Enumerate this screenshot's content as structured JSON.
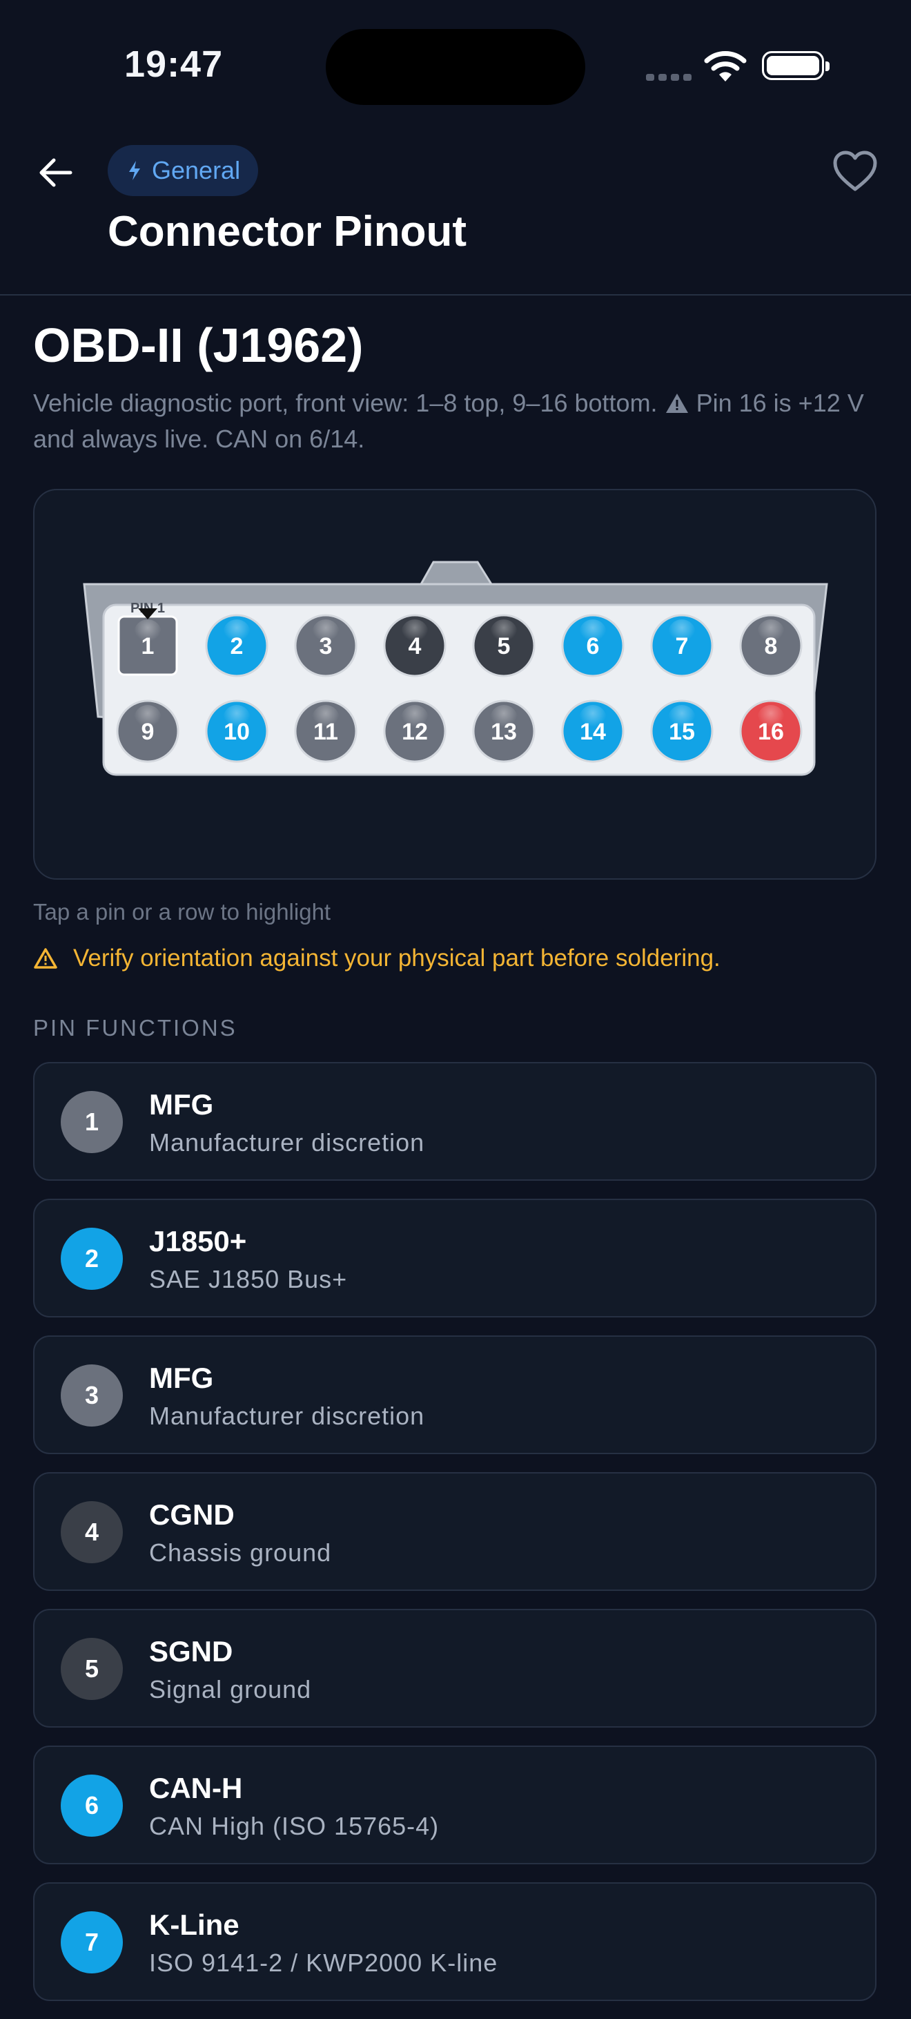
{
  "status": {
    "time": "19:47"
  },
  "header": {
    "category_chip": "General",
    "title": "Connector Pinout",
    "icons": {
      "back": "arrow-left-icon",
      "category": "bolt-icon",
      "favorite": "heart-icon"
    }
  },
  "connector": {
    "title": "OBD-II (J1962)",
    "description_part1": "Vehicle diagnostic port, front view: 1–8 top, 9–16 bottom.",
    "description_part2": "Pin 16 is +12 V and always live. CAN on 6/14.",
    "pin1_marker": "PIN 1",
    "top_row": [
      {
        "n": "1",
        "kind": "pin1"
      },
      {
        "n": "2",
        "kind": "blue"
      },
      {
        "n": "3",
        "kind": "gray"
      },
      {
        "n": "4",
        "kind": "dark"
      },
      {
        "n": "5",
        "kind": "dark"
      },
      {
        "n": "6",
        "kind": "blue"
      },
      {
        "n": "7",
        "kind": "blue"
      },
      {
        "n": "8",
        "kind": "gray"
      }
    ],
    "bottom_row": [
      {
        "n": "9",
        "kind": "gray"
      },
      {
        "n": "10",
        "kind": "blue"
      },
      {
        "n": "11",
        "kind": "gray"
      },
      {
        "n": "12",
        "kind": "gray"
      },
      {
        "n": "13",
        "kind": "gray"
      },
      {
        "n": "14",
        "kind": "blue"
      },
      {
        "n": "15",
        "kind": "blue"
      },
      {
        "n": "16",
        "kind": "red"
      }
    ],
    "hint": "Tap a pin or a row to highlight",
    "caution": "Verify orientation against your physical part before soldering."
  },
  "colors": {
    "blue": "#12a3e6",
    "gray": "#6b717d",
    "dark": "#3a3f48",
    "red": "#e5484d",
    "caution": "#f4b534",
    "chip_text": "#61a8f3"
  },
  "pin_functions": {
    "label": "PIN FUNCTIONS",
    "items": [
      {
        "num": "1",
        "name": "MFG",
        "desc": "Manufacturer discretion",
        "color": "#6b717d"
      },
      {
        "num": "2",
        "name": "J1850+",
        "desc": "SAE J1850 Bus+",
        "color": "#12a3e6"
      },
      {
        "num": "3",
        "name": "MFG",
        "desc": "Manufacturer discretion",
        "color": "#6b717d"
      },
      {
        "num": "4",
        "name": "CGND",
        "desc": "Chassis ground",
        "color": "#3a3f48"
      },
      {
        "num": "5",
        "name": "SGND",
        "desc": "Signal ground",
        "color": "#3a3f48"
      },
      {
        "num": "6",
        "name": "CAN-H",
        "desc": "CAN High (ISO 15765-4)",
        "color": "#12a3e6"
      },
      {
        "num": "7",
        "name": "K-Line",
        "desc": "ISO 9141-2 / KWP2000 K-line",
        "color": "#12a3e6"
      }
    ]
  }
}
